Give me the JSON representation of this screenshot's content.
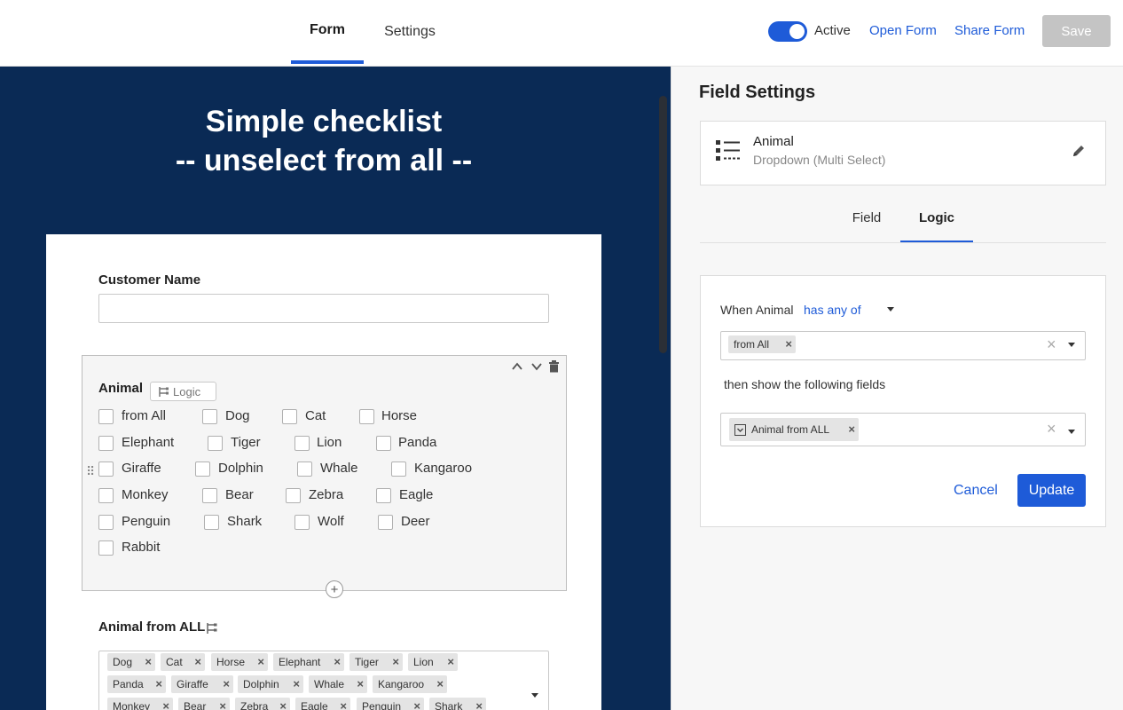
{
  "topbar": {
    "tabs": [
      {
        "label": "Form",
        "active": true
      },
      {
        "label": "Settings",
        "active": false
      }
    ],
    "active_label": "Active",
    "open_form": "Open Form",
    "share_form": "Share Form",
    "save_label": "Save",
    "accent_color": "#1e5bd8"
  },
  "form": {
    "title_line1": "Simple checklist",
    "title_line2": "-- unselect from all --",
    "background_color": "#0a2a55",
    "customer_name_label": "Customer Name",
    "animal_label": "Animal",
    "logic_chip": "Logic",
    "animal_options": [
      "from All",
      "Dog",
      "Cat",
      "Horse",
      "Elephant",
      "Tiger",
      "Lion",
      "Panda",
      "Giraffe",
      "Dolphin",
      "Whale",
      "Kangaroo",
      "Monkey",
      "Bear",
      "Zebra",
      "Eagle",
      "Penguin",
      "Shark",
      "Wolf",
      "Deer",
      "Rabbit"
    ],
    "animal_from_all_label": "Animal from ALL",
    "animal_from_all_selected": [
      "Dog",
      "Cat",
      "Horse",
      "Elephant",
      "Tiger",
      "Lion",
      "Panda",
      "Giraffe",
      "Dolphin",
      "Whale",
      "Kangaroo",
      "Monkey",
      "Bear",
      "Zebra",
      "Eagle",
      "Penguin",
      "Shark"
    ]
  },
  "panel": {
    "title": "Field Settings",
    "field_name": "Animal",
    "field_type": "Dropdown (Multi Select)",
    "tabs": [
      {
        "label": "Field",
        "active": false
      },
      {
        "label": "Logic",
        "active": true
      }
    ],
    "logic": {
      "when_text": "When Animal",
      "condition": "has any of",
      "values": [
        "from All"
      ],
      "then_text": "then show the following fields",
      "fields": [
        "Animal from ALL"
      ],
      "cancel_label": "Cancel",
      "update_label": "Update"
    }
  }
}
